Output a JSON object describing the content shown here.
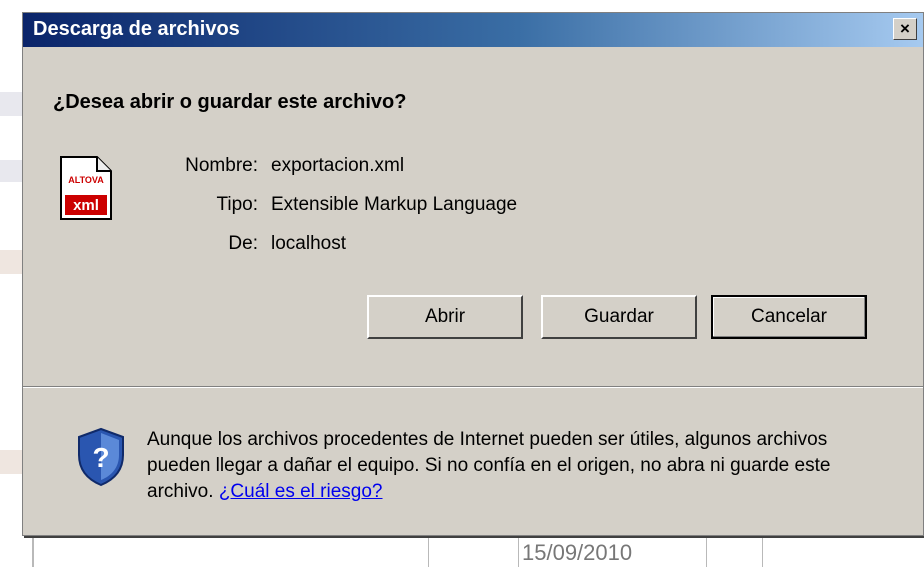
{
  "dialog": {
    "title": "Descarga de archivos",
    "close_glyph": "×",
    "question": "¿Desea abrir o guardar este archivo?",
    "file_icon": {
      "name": "xml-file-icon",
      "brand_text": "ALTOVA",
      "ext_text": "xml"
    },
    "fields": [
      {
        "label": "Nombre:",
        "value": "exportacion.xml"
      },
      {
        "label": "Tipo:",
        "value": "Extensible Markup Language"
      },
      {
        "label": "De:",
        "value": "localhost"
      }
    ],
    "buttons": {
      "open": "Abrir",
      "save": "Guardar",
      "cancel": "Cancelar"
    },
    "warning": {
      "text": "Aunque los archivos procedentes de Internet pueden ser útiles, algunos archivos pueden llegar a dañar el equipo. Si no confía en el origen, no abra ni guarde este archivo. ",
      "link": "¿Cuál es el riesgo?"
    }
  },
  "background": {
    "date": "15/09/2010"
  },
  "colors": {
    "dialog_bg": "#d4d0c8",
    "titlebar_start": "#0a246a",
    "titlebar_end": "#a6caf0",
    "link": "#0000ee"
  }
}
